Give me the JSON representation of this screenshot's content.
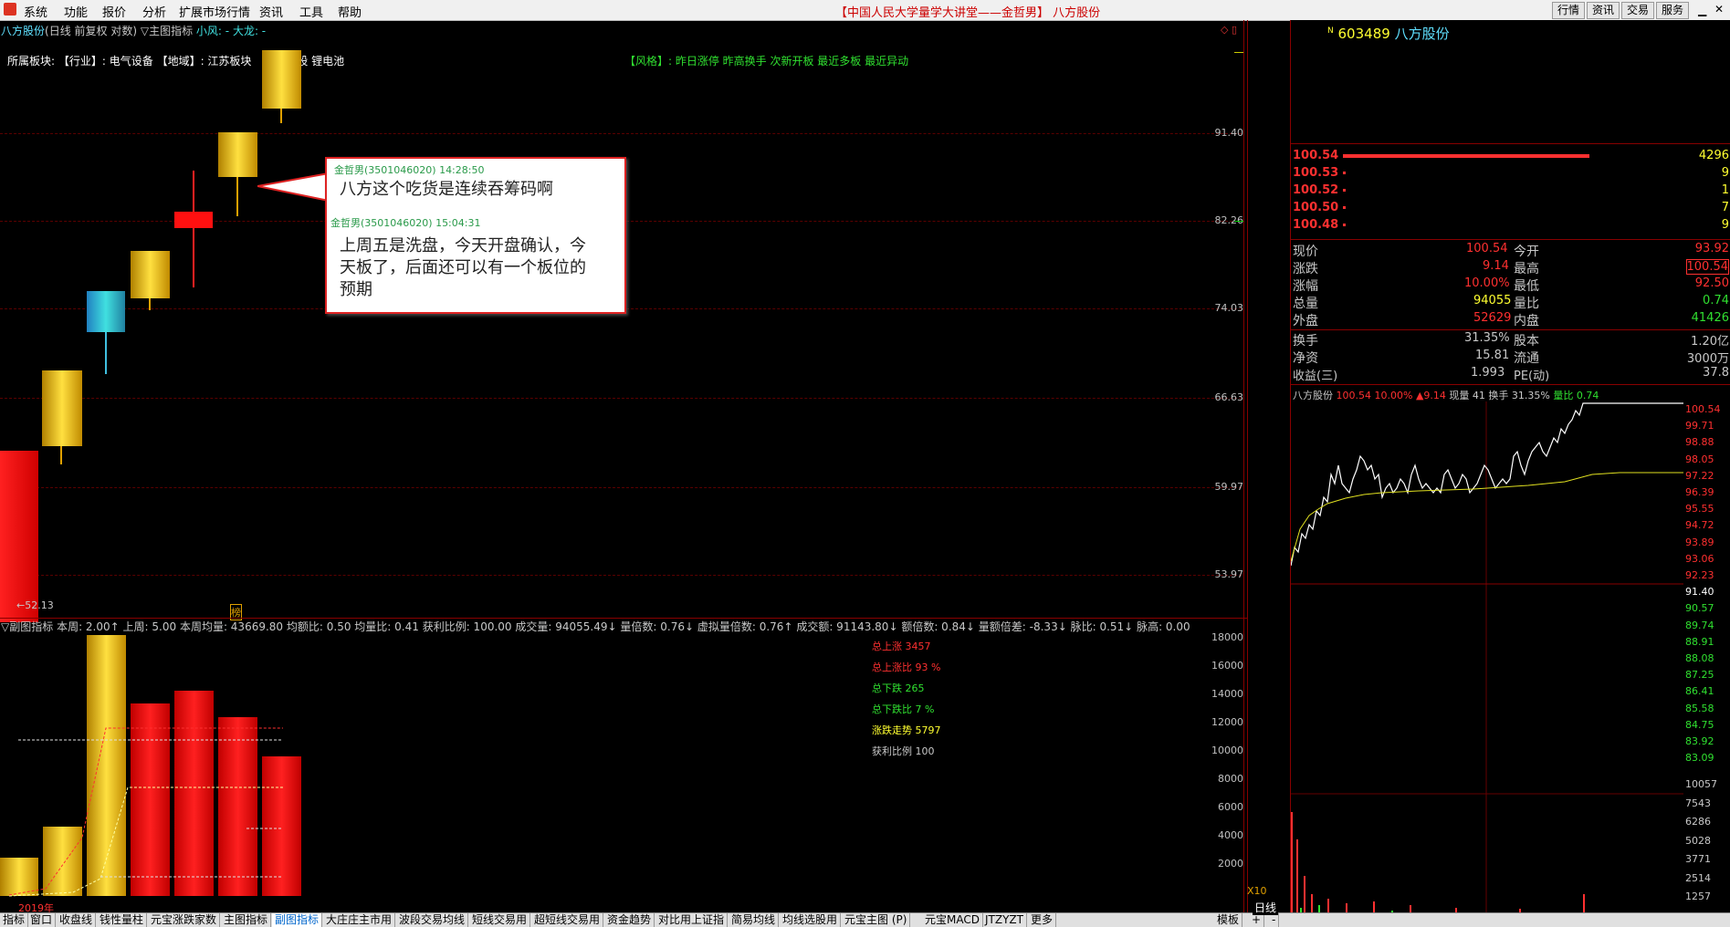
{
  "menubar": {
    "items": [
      "系统",
      "功能",
      "报价",
      "分析",
      "扩展市场行情",
      "资讯",
      "工具",
      "帮助"
    ],
    "title": "【中国人民大学量学大讲堂——金哲男】 八方股份",
    "right_buttons": [
      "行情",
      "资讯",
      "交易",
      "服务"
    ]
  },
  "chart_header": {
    "stock": "八方股份",
    "mode": "(日线 前复权 对数)",
    "indicator": "▽主图指标",
    "small_wind": "小风: -",
    "big_dragon": "大龙: -"
  },
  "sector_line": {
    "label": "所属板块:",
    "industry": "【行业】: 电气设备",
    "region": "【地域】: 江苏板块",
    "concept": "次新股 锂电池"
  },
  "style_line": "【风格】: 昨日涨停 昨高换手 次新开板 最近多板 最近异动",
  "main_axis": [
    "91.40",
    "82.26",
    "74.03",
    "66.63",
    "59.97",
    "53.97"
  ],
  "low_marker": "←52.13",
  "chat": {
    "msg1_header": "金哲男(3501046020) 14:28:50",
    "msg1_text": "八方这个吃货是连续吞筹码啊",
    "msg2_header": "金哲男(3501046020) 15:04:31",
    "msg2_lines": [
      "上周五是洗盘，今天开盘确认，今",
      "天板了，后面还可以有一个板位的",
      "预期"
    ]
  },
  "sub_header": {
    "label": "▽副图指标",
    "items": [
      "本周: 2.00↑",
      "上周: 5.00",
      "本周均量: 43669.80",
      "均额比: 0.50",
      "均量比: 0.41",
      "获利比例: 100.00",
      "成交量: 94055.49↓",
      "量倍数: 0.76↓",
      "虚拟量倍数: 0.76↑",
      "成交额: 91143.80↓",
      "额倍数: 0.84↓",
      "量额倍差: -8.33↓",
      "脉比: 0.51↓",
      "脉高: 0.00"
    ]
  },
  "sub_axis": [
    "18000",
    "16000",
    "14000",
    "12000",
    "10000",
    "8000",
    "6000",
    "4000",
    "2000"
  ],
  "sub_axis_bottom": "X10",
  "sub_stats": [
    {
      "text": "总上涨 3457",
      "color": "#ff3030"
    },
    {
      "text": "总上涨比 93 %",
      "color": "#ff3030"
    },
    {
      "text": "总下跌 265",
      "color": "#30e030"
    },
    {
      "text": "总下跌比 7 %",
      "color": "#30e030"
    },
    {
      "text": "涨跌走势 5797",
      "color": "#ffff30"
    },
    {
      "text": "获利比例 100",
      "color": "#c8c8c8"
    }
  ],
  "year_label": "2019年",
  "day_label": "日线",
  "bang_label": "榜",
  "right": {
    "code_prefix": "N",
    "code": "603489",
    "name": "八方股份",
    "order_book": [
      {
        "price": "100.54",
        "vol": "4296",
        "bar": 0.6
      },
      {
        "price": "100.53",
        "vol": "9",
        "bar": 0.01
      },
      {
        "price": "100.52",
        "vol": "1",
        "bar": 0.01
      },
      {
        "price": "100.50",
        "vol": "7",
        "bar": 0.01
      },
      {
        "price": "100.48",
        "vol": "9",
        "bar": 0.01
      }
    ],
    "quote_rows": [
      [
        "现价",
        "100.54",
        "今开",
        "93.92"
      ],
      [
        "涨跌",
        "9.14",
        "最高",
        "100.54"
      ],
      [
        "涨幅",
        "10.00%",
        "最低",
        "92.50"
      ],
      [
        "总量",
        "94055",
        "量比",
        "0.74"
      ],
      [
        "外盘",
        "52629",
        "内盘",
        "41426"
      ]
    ],
    "info_rows": [
      [
        "换手",
        "31.35%",
        "股本",
        "1.20亿"
      ],
      [
        "净资",
        "15.81",
        "流通",
        "3000万"
      ],
      [
        "收益(三)",
        "1.993",
        "PE(动)",
        "37.8"
      ]
    ],
    "intraday_header": {
      "name": "八方股份",
      "price": "100.54",
      "pct": "10.00%",
      "chg": "▲9.14",
      "now_vol": "现量 41",
      "turnover": "换手 31.35%",
      "vol_ratio": "量比 0.74"
    },
    "price_axis": [
      "100.54",
      "99.71",
      "98.88",
      "98.05",
      "97.22",
      "96.39",
      "95.55",
      "94.72",
      "93.89",
      "93.06",
      "92.23",
      "91.40",
      "90.57",
      "89.74",
      "88.91",
      "88.08",
      "87.25",
      "86.41",
      "85.58",
      "84.75",
      "83.92",
      "83.09"
    ],
    "vol_axis": [
      "10057",
      "7543",
      "6286",
      "5028",
      "3771",
      "2514",
      "1257"
    ]
  },
  "tabs": [
    "指标",
    "窗口",
    "收盘线",
    "钱性量柱",
    "元宝涨跌家数",
    "主图指标",
    "副图指标",
    "大庄庄主市用",
    "波段交易均线",
    "短线交易用",
    "超短线交易用",
    "资金趋势",
    "对比用上证指",
    "简易均线",
    "均线选股用",
    "元宝主图 (P)",
    "元宝MACD",
    "JTZYZT",
    "更多"
  ],
  "tab_right": [
    "模板",
    "+",
    "-"
  ]
}
